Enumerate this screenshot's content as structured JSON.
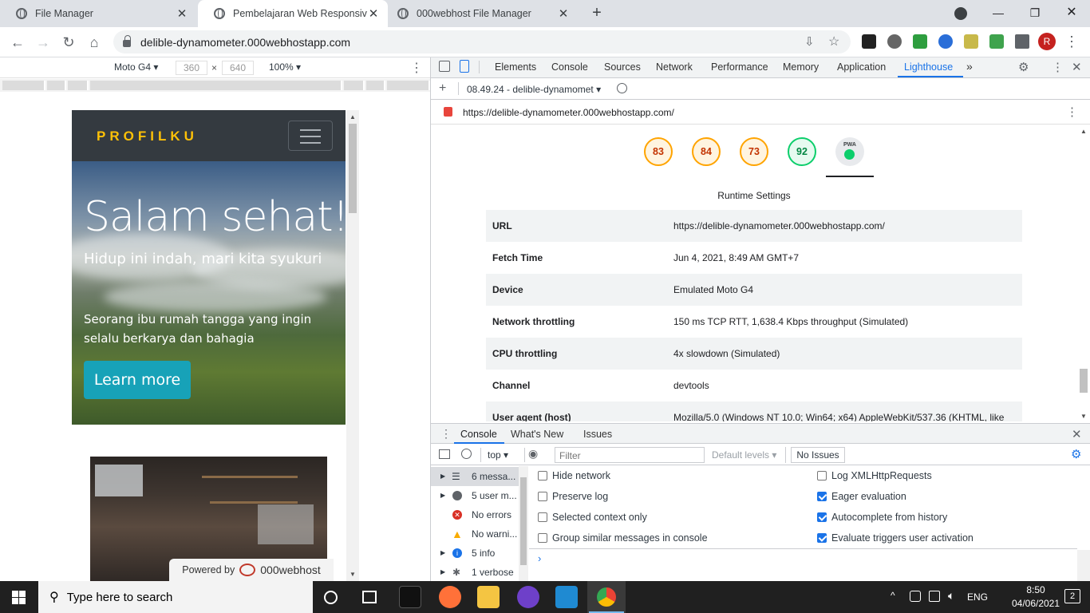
{
  "browser": {
    "tabs": [
      {
        "title": "File Manager",
        "active": false
      },
      {
        "title": "Pembelajaran Web Responsive",
        "active": true
      },
      {
        "title": "000webhost File Manager",
        "active": false
      }
    ],
    "url": "delible-dynamometer.000webhostapp.com",
    "profile_initial": "R"
  },
  "device_toolbar": {
    "device": "Moto G4",
    "width": "360",
    "times": "×",
    "height": "640",
    "zoom": "100%"
  },
  "mobile_page": {
    "brand": "PROFILKU",
    "hero_title": "Salam sehat!",
    "hero_subtitle": "Hidup ini indah, mari kita syukuri",
    "hero_text": "Seorang ibu rumah tangga yang ingin selalu berkarya dan bahagia",
    "cta_label": "Learn more",
    "powered_prefix": "Powered by",
    "powered_brand": "000webhost"
  },
  "devtools": {
    "tabs": [
      "Elements",
      "Console",
      "Sources",
      "Network",
      "Performance",
      "Memory",
      "Application",
      "Lighthouse"
    ],
    "selected_tab": "Lighthouse",
    "report_selector": "08.49.24 - delible-dynamomet",
    "report_url": "https://delible-dynamometer.000webhostapp.com/",
    "scores": [
      {
        "value": "83",
        "color": "#ffa400"
      },
      {
        "value": "84",
        "color": "#ffa400"
      },
      {
        "value": "73",
        "color": "#ffa400"
      },
      {
        "value": "92",
        "color": "#0cce6b"
      }
    ],
    "pwa_label": "PWA",
    "runtime_settings_title": "Runtime Settings",
    "runtime_settings": [
      {
        "key": "URL",
        "value": "https://delible-dynamometer.000webhostapp.com/"
      },
      {
        "key": "Fetch Time",
        "value": "Jun 4, 2021, 8:49 AM GMT+7"
      },
      {
        "key": "Device",
        "value": "Emulated Moto G4"
      },
      {
        "key": "Network throttling",
        "value": "150 ms TCP RTT, 1,638.4 Kbps throughput (Simulated)"
      },
      {
        "key": "CPU throttling",
        "value": "4x slowdown (Simulated)"
      },
      {
        "key": "Channel",
        "value": "devtools"
      },
      {
        "key": "User agent (host)",
        "value": "Mozilla/5.0 (Windows NT 10.0; Win64; x64) AppleWebKit/537.36 (KHTML, like"
      }
    ]
  },
  "drawer": {
    "tabs": [
      "Console",
      "What's New",
      "Issues"
    ],
    "context": "top",
    "filter_placeholder": "Filter",
    "levels": "Default levels",
    "issues": "No Issues",
    "sidebar": [
      {
        "label": "6 messa...",
        "icon": "list-icon"
      },
      {
        "label": "5 user m...",
        "icon": "user-icon"
      },
      {
        "label": "No errors",
        "icon": "error-icon"
      },
      {
        "label": "No warni...",
        "icon": "warning-icon"
      },
      {
        "label": "5 info",
        "icon": "info-icon"
      },
      {
        "label": "1 verbose",
        "icon": "bug-icon"
      }
    ],
    "settings_left": [
      {
        "label": "Hide network",
        "checked": false
      },
      {
        "label": "Preserve log",
        "checked": false
      },
      {
        "label": "Selected context only",
        "checked": false
      },
      {
        "label": "Group similar messages in console",
        "checked": false
      }
    ],
    "settings_right": [
      {
        "label": "Log XMLHttpRequests",
        "checked": false
      },
      {
        "label": "Eager evaluation",
        "checked": true
      },
      {
        "label": "Autocomplete from history",
        "checked": true
      },
      {
        "label": "Evaluate triggers user activation",
        "checked": true
      }
    ]
  },
  "taskbar": {
    "search_placeholder": "Type here to search",
    "language": "ENG",
    "time": "8:50",
    "date": "04/06/2021",
    "notifications": "2"
  }
}
